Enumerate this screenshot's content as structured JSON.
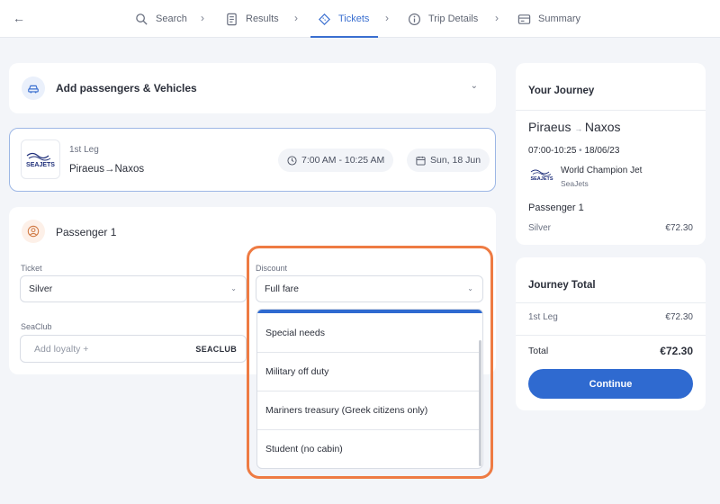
{
  "nav": {
    "steps": [
      {
        "label": "Search",
        "icon": "search-icon"
      },
      {
        "label": "Results",
        "icon": "document-icon"
      },
      {
        "label": "Tickets",
        "icon": "ticket-icon",
        "active": true
      },
      {
        "label": "Trip Details",
        "icon": "info-icon"
      },
      {
        "label": "Summary",
        "icon": "summary-icon"
      }
    ]
  },
  "add_passengers": {
    "title": "Add passengers & Vehicles"
  },
  "leg": {
    "label": "1st Leg",
    "route": "Piraeus→Naxos",
    "time": "7:00 AM - 10:25 AM",
    "date": "Sun, 18 Jun",
    "operator_logo": "SEAJETS"
  },
  "passenger": {
    "title": "Passenger 1",
    "ticket_label": "Ticket",
    "ticket_value": "Silver",
    "discount_label": "Discount",
    "discount_value": "Full fare",
    "seaclub_label": "SeaClub",
    "seaclub_placeholder": "Add loyalty  +",
    "seaclub_brand": "SEACLUB"
  },
  "discount_options": [
    "Special needs",
    "Military off duty",
    "Mariners treasury (Greek citizens only)",
    "Student (no cabin)"
  ],
  "journey": {
    "title": "Your Journey",
    "from": "Piraeus",
    "to": "Naxos",
    "times": "07:00-10:25",
    "date": "18/06/23",
    "vessel": "World Champion Jet",
    "operator": "SeaJets",
    "passenger": "Passenger 1",
    "tier": "Silver",
    "price": "€72.30"
  },
  "total": {
    "title": "Journey Total",
    "leg_label": "1st Leg",
    "leg_price": "€72.30",
    "total_label": "Total",
    "total_price": "€72.30",
    "button": "Continue"
  },
  "colors": {
    "accent": "#2f6ad0",
    "highlight": "#ee7b43"
  }
}
